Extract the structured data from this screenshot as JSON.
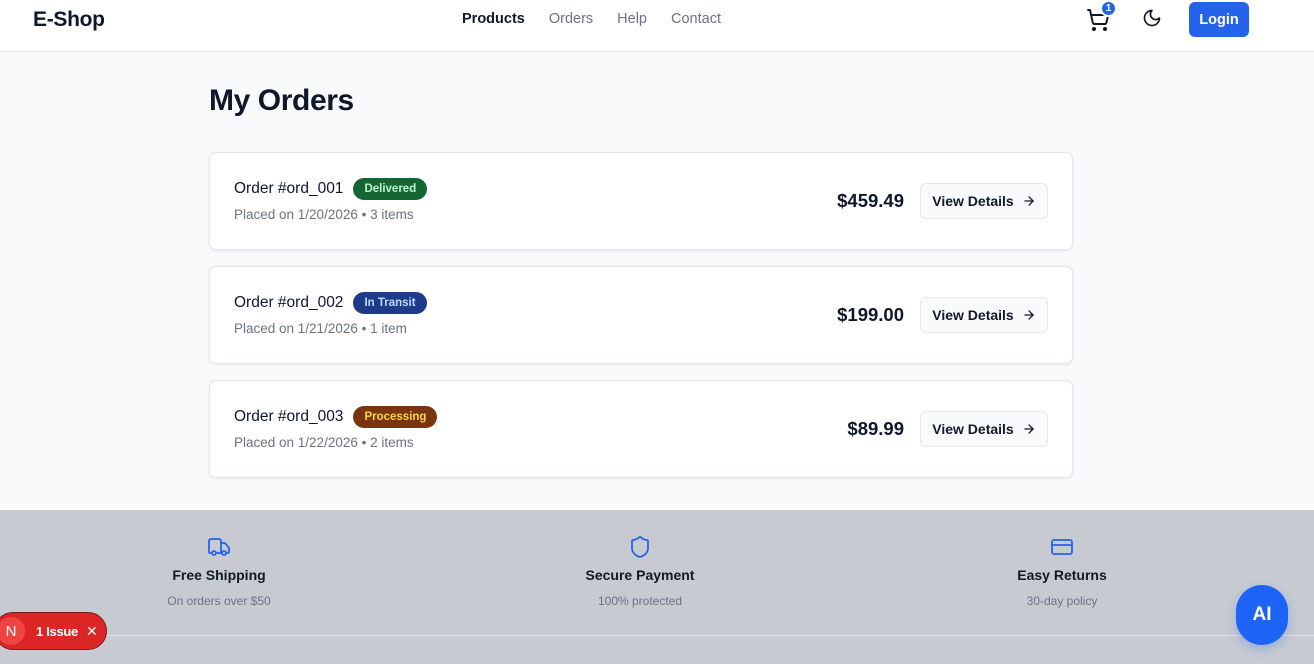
{
  "header": {
    "logo": "E-Shop",
    "nav": [
      {
        "label": "Products",
        "active": true
      },
      {
        "label": "Orders",
        "active": false
      },
      {
        "label": "Help",
        "active": false
      },
      {
        "label": "Contact",
        "active": false
      }
    ],
    "cart_icon": "cart-icon",
    "cart_count": "1",
    "theme_icon": "moon-icon",
    "login_label": "Login"
  },
  "page": {
    "title": "My Orders"
  },
  "orders": [
    {
      "id": "Order #ord_001",
      "status": "Delivered",
      "status_bg": "#166534",
      "status_color": "#bbf7d0",
      "meta": "Placed on 1/20/2026 • 3 items",
      "total": "$459.49",
      "button_label": "View Details"
    },
    {
      "id": "Order #ord_002",
      "status": "In Transit",
      "status_bg": "#1e3a8a",
      "status_color": "#bfdbfe",
      "meta": "Placed on 1/21/2026 • 1 item",
      "total": "$199.00",
      "button_label": "View Details"
    },
    {
      "id": "Order #ord_003",
      "status": "Processing",
      "status_bg": "#78350f",
      "status_color": "#fcd34d",
      "meta": "Placed on 1/22/2026 • 2 items",
      "total": "$89.99",
      "button_label": "View Details"
    }
  ],
  "features": [
    {
      "icon": "truck-icon",
      "title": "Free Shipping",
      "desc": "On orders over $50"
    },
    {
      "icon": "shield-icon",
      "title": "Secure Payment",
      "desc": "100% protected"
    },
    {
      "icon": "credit-card-icon",
      "title": "Easy Returns",
      "desc": "30-day policy"
    }
  ],
  "issue_badge": {
    "letter": "N",
    "label": "1 Issue",
    "close": "✕"
  },
  "ai_button": {
    "label": "AI"
  },
  "colors": {
    "accent": "#2563eb",
    "issue": "#dc2626"
  }
}
